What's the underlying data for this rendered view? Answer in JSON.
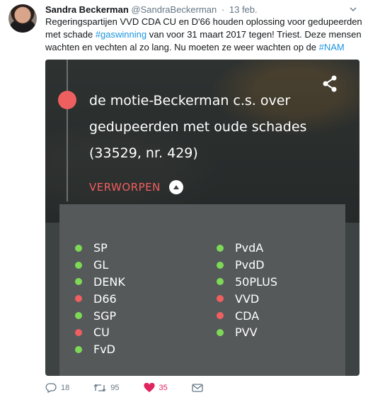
{
  "tweet": {
    "name": "Sandra Beckerman",
    "handle": "@SandraBeckerman",
    "separator": "·",
    "date": "13 feb.",
    "text_part1": "Regeringspartijen VVD CDA CU en D'66 houden oplossing voor gedupeerden met schade ",
    "hashtag1": "#gaswinning",
    "text_part2": " van voor 31 maart 2017 tegen! Triest. Deze mensen wachten en vechten al zo lang. Nu moeten ze weer wachten op de ",
    "hashtag2": "#NAM"
  },
  "card": {
    "motion_title": "de motie-Beckerman c.s. over gedupeerden met oude schades (33529, nr. 429)",
    "result": "VERWORPEN",
    "colors": {
      "for": "#7ed957",
      "against": "#f05f5f"
    },
    "votes_left": [
      {
        "party": "SP",
        "vote": "for"
      },
      {
        "party": "GL",
        "vote": "for"
      },
      {
        "party": "DENK",
        "vote": "for"
      },
      {
        "party": "D66",
        "vote": "against"
      },
      {
        "party": "SGP",
        "vote": "for"
      },
      {
        "party": "CU",
        "vote": "against"
      },
      {
        "party": "FvD",
        "vote": "for"
      }
    ],
    "votes_right": [
      {
        "party": "PvdA",
        "vote": "for"
      },
      {
        "party": "PvdD",
        "vote": "for"
      },
      {
        "party": "50PLUS",
        "vote": "for"
      },
      {
        "party": "VVD",
        "vote": "against"
      },
      {
        "party": "CDA",
        "vote": "against"
      },
      {
        "party": "PVV",
        "vote": "for"
      }
    ]
  },
  "actions": {
    "replies": "18",
    "retweets": "95",
    "likes": "35",
    "icons": [
      "reply-icon",
      "retweet-icon",
      "heart-icon",
      "message-icon"
    ]
  }
}
